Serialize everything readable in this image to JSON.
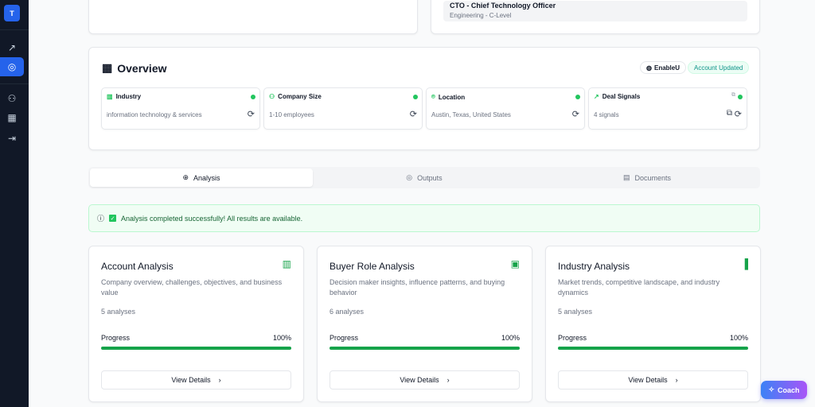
{
  "sidebar": {
    "logo": "T",
    "icons": [
      "trending-up",
      "target",
      "user",
      "building",
      "logout"
    ]
  },
  "top": {
    "role_title": "CTO - Chief Technology Officer",
    "role_sub": "Engineering - C-Level"
  },
  "overview": {
    "title": "Overview",
    "company_badge": "EnableU",
    "status_badge": "Account Updated",
    "tiles": [
      {
        "label": "Industry",
        "value": "information technology & services"
      },
      {
        "label": "Company Size",
        "value": "1-10 employees"
      },
      {
        "label": "Location",
        "value": "Austin, Texas, United States"
      },
      {
        "label": "Deal Signals",
        "value": "4 signals"
      }
    ]
  },
  "tabs": [
    {
      "label": "Analysis"
    },
    {
      "label": "Outputs"
    },
    {
      "label": "Documents"
    }
  ],
  "alert": "Analysis completed successfully! All results are available.",
  "cards": [
    {
      "title": "Account Analysis",
      "desc": "Company overview, challenges, objectives, and business value",
      "count": "5 analyses",
      "progress_label": "Progress",
      "progress": "100%",
      "progress_value": 100,
      "button": "View Details"
    },
    {
      "title": "Buyer Role Analysis",
      "desc": "Decision maker insights, influence patterns, and buying behavior",
      "count": "6 analyses",
      "progress_label": "Progress",
      "progress": "100%",
      "progress_value": 100,
      "button": "View Details"
    },
    {
      "title": "Industry Analysis",
      "desc": "Market trends, competitive landscape, and industry dynamics",
      "count": "5 analyses",
      "progress_label": "Progress",
      "progress": "100%",
      "progress_value": 100,
      "button": "View Details"
    }
  ],
  "coach": "Coach"
}
